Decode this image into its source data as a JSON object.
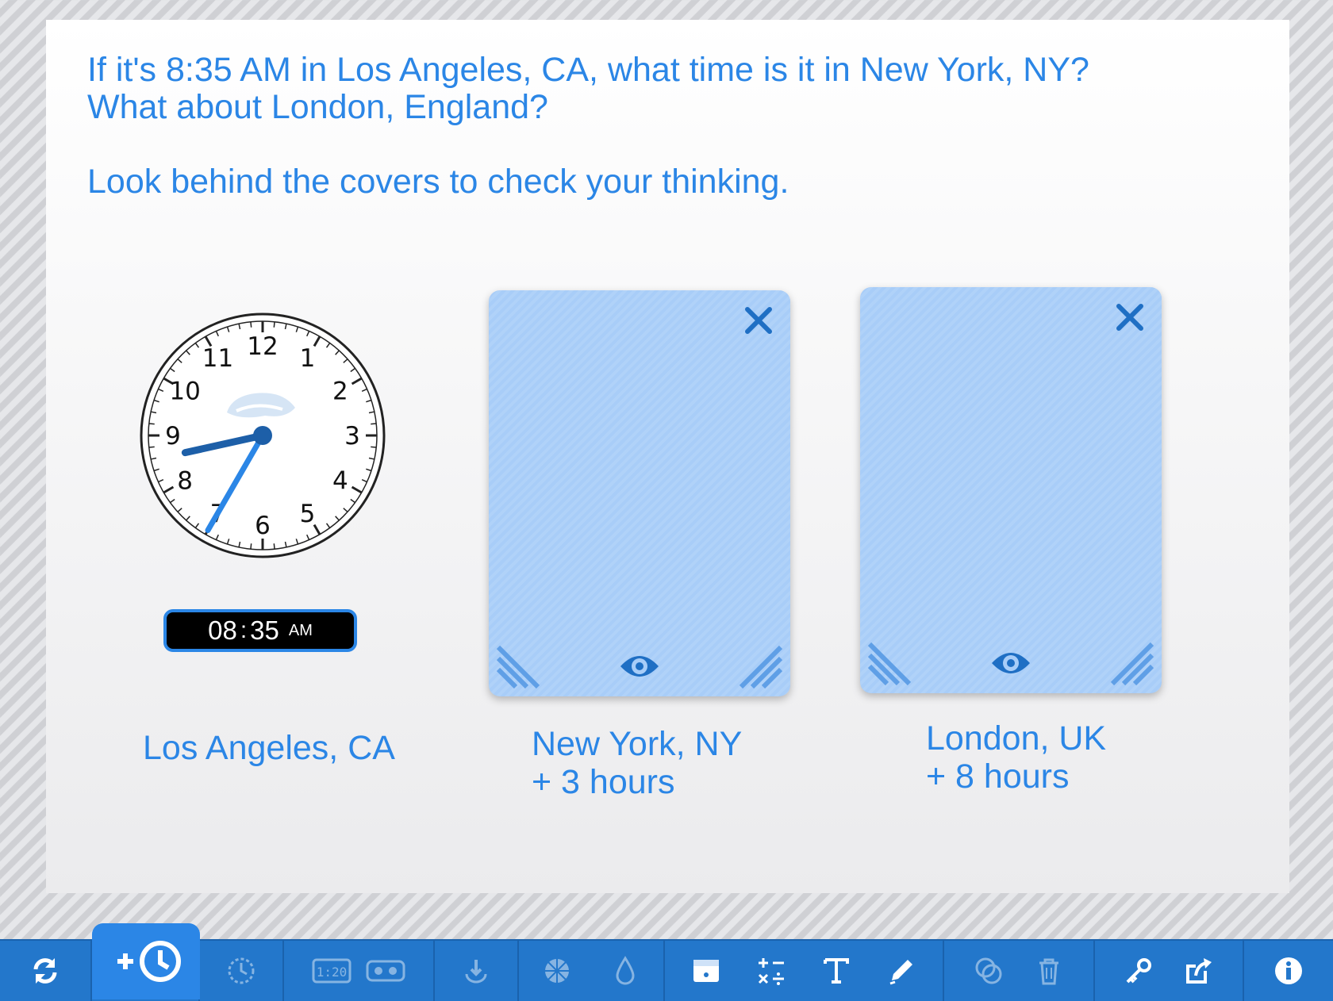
{
  "prompt": {
    "line1": "If it's 8:35 AM in Los Angeles, CA, what time is it in New York, NY?",
    "line2": "What about London, England?",
    "line3": "Look behind the covers to check your thinking."
  },
  "clock": {
    "numerals": [
      "12",
      "1",
      "2",
      "3",
      "4",
      "5",
      "6",
      "7",
      "8",
      "9",
      "10",
      "11"
    ],
    "hour": 8,
    "minute": 35,
    "digital": {
      "hours": "08",
      "separator": ":",
      "minutes": "35",
      "ampm": "AM"
    }
  },
  "cities": {
    "la": {
      "name": "Los Angeles, CA"
    },
    "ny": {
      "name": "New York, NY",
      "offset": "+ 3 hours"
    },
    "london": {
      "name": "London, UK",
      "offset": "+ 8 hours"
    }
  },
  "colors": {
    "accent": "#2b86e6",
    "cover": "#a8cdf8",
    "toolbar": "#2377cb"
  },
  "toolbar": {
    "items": [
      "reset-icon",
      "add-clock-icon",
      "timer-icon",
      "digital-display-icon",
      "loop-icon",
      "touch-icon",
      "fill-wheel-icon",
      "drop-icon",
      "cover-icon",
      "math-icon",
      "text-icon",
      "pencil-icon",
      "clock-overlap-icon",
      "trash-icon",
      "key-icon",
      "share-icon",
      "info-icon"
    ]
  }
}
